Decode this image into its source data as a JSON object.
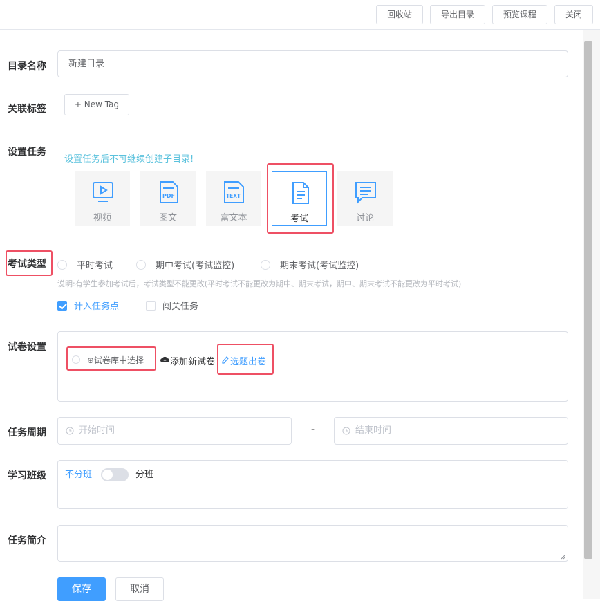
{
  "topbar": {
    "recycle_label": "回收站",
    "export_label": "导出目录",
    "preview_label": "预览课程",
    "close_label": "关闭"
  },
  "form": {
    "dir_name_label": "目录名称",
    "dir_name_value": "新建目录",
    "tag_label": "关联标签",
    "new_tag_label": "+ New Tag",
    "task_label": "设置任务",
    "task_hint": "设置任务后不可继续创建子目录!",
    "task_types": [
      {
        "label": "视频",
        "icon": "video-icon"
      },
      {
        "label": "图文",
        "icon": "pdf-icon"
      },
      {
        "label": "富文本",
        "icon": "text-icon"
      },
      {
        "label": "考试",
        "icon": "exam-icon"
      },
      {
        "label": "讨论",
        "icon": "discussion-icon"
      }
    ],
    "selected_task": "考试",
    "exam_type_label": "考试类型",
    "exam_types": [
      "平时考试",
      "期中考试(考试监控)",
      "期末考试(考试监控)"
    ],
    "exam_note": "说明:有学生参加考试后，考试类型不能更改(平时考试不能更改为期中、期末考试，期中、期末考试不能更改为平时考试)",
    "count_task_label": "计入任务点",
    "count_task_checked": true,
    "gate_task_label": "闯关任务",
    "gate_task_checked": false,
    "paper_label": "试卷设置",
    "paper_from_bank": "⊕试卷库中选择",
    "paper_add_new": "添加新试卷",
    "paper_pick": "选题出卷",
    "period_label": "任务周期",
    "start_placeholder": "开始时间",
    "period_sep": "-",
    "end_placeholder": "结束时间",
    "class_label": "学习班级",
    "class_no_split": "不分班",
    "class_split": "分班",
    "intro_label": "任务简介",
    "save_label": "保存",
    "cancel_label": "取消"
  },
  "colors": {
    "primary": "#409eff",
    "highlight_red": "#ee5064",
    "hint_cyan": "#5bc2dd"
  }
}
